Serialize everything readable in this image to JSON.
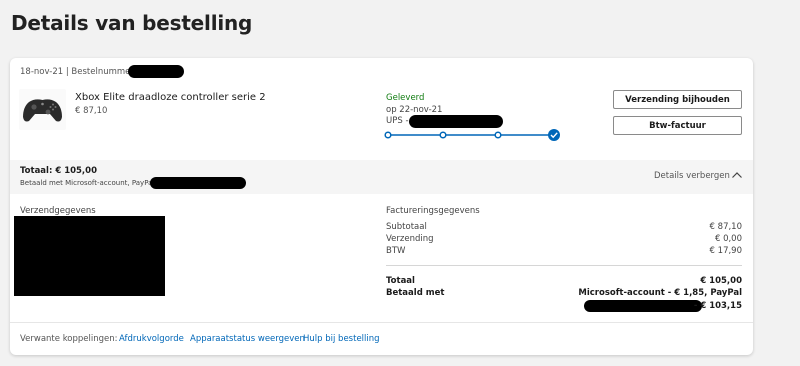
{
  "page": {
    "title": "Details van bestelling"
  },
  "order": {
    "date_label": "18-nov-21 | Bestelnummer",
    "product": {
      "name": "Xbox Elite draadloze controller serie 2",
      "price": "€ 87,10",
      "thumbnail_icon": "controller-icon"
    },
    "shipping_status": {
      "status": "Geleverd",
      "date": "op 22-nov-21",
      "carrier": "UPS -",
      "steps_total": 4,
      "steps_completed": 4
    },
    "actions": {
      "track_label": "Verzending bijhouden",
      "invoice_label": "Btw-factuur"
    }
  },
  "summary": {
    "total": "Totaal: € 105,00",
    "paid_with": "Betaald met Microsoft-account, PayPal",
    "details_toggle": "Details verbergen"
  },
  "shipping": {
    "heading": "Verzendgegevens"
  },
  "billing": {
    "heading": "Factureringsgegevens",
    "rows": [
      {
        "label": "Subtotaal",
        "value": "€ 87,10"
      },
      {
        "label": "Verzending",
        "value": "€ 0,00"
      },
      {
        "label": "BTW",
        "value": "€ 17,90"
      }
    ],
    "total_label": "Totaal",
    "total_value": "€ 105,00",
    "paid_label": "Betaald met",
    "paid_value_1": "Microsoft-account - € 1,85, PayPal",
    "paid_value_2": "- € 103,15"
  },
  "related": {
    "label": "Verwante koppelingen:",
    "links": [
      "Afdrukvolgorde",
      "Apparaatstatus weergeven",
      "Hulp bij bestelling"
    ]
  },
  "colors": {
    "status_green": "#107c10",
    "link_blue": "#0067b8",
    "progress_blue": "#0067b8"
  }
}
